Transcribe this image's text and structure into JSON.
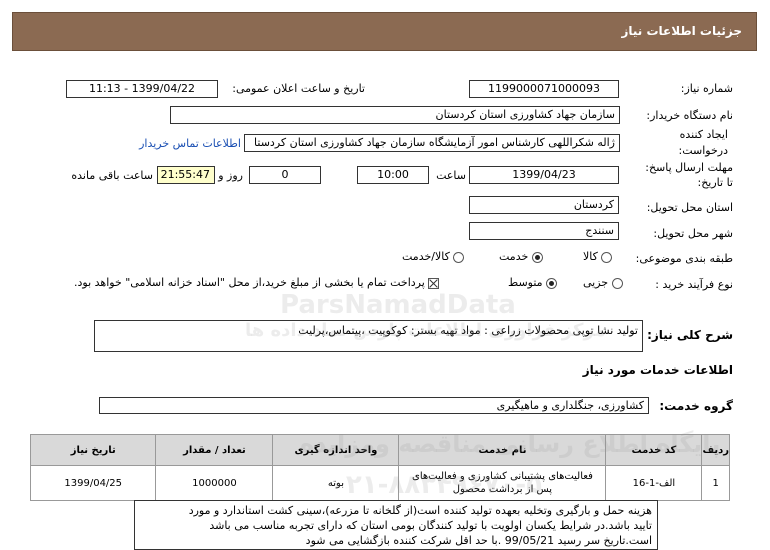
{
  "header": {
    "title": "جزئیات اطلاعات نیاز"
  },
  "fields": {
    "need_number_label": "شماره نیاز:",
    "need_number": "1199000071000093",
    "announce_label": "تاریخ و ساعت اعلان عمومی:",
    "announce_value": "1399/04/22 - 11:13",
    "buyer_label": "نام دستگاه خریدار:",
    "buyer_value": "سازمان جهاد کشاورزی استان کردستان",
    "creator_label_1": "ایجاد کننده",
    "creator_label_2": "درخواست:",
    "creator_value": "ژاله شکراللهی کارشناس امور آزمایشگاه سازمان جهاد کشاورزی استان کردستا",
    "contact_link": "اطلاعات تماس خریدار",
    "deadline_label_1": "مهلت ارسال پاسخ:",
    "deadline_label_2": "تا تاریخ:",
    "deadline_date": "1399/04/23",
    "time_label": "ساعت",
    "deadline_time": "10:00",
    "days_value": "0",
    "days_label": "روز و",
    "remaining_time": "21:55:47",
    "remaining_label": "ساعت باقی مانده",
    "province_label": "استان محل تحویل:",
    "province_value": "کردستان",
    "city_label": "شهر محل تحویل:",
    "city_value": "سنندج",
    "category_label": "طبقه بندی موضوعی:",
    "category_options": [
      "کالا",
      "خدمت",
      "کالا/خدمت"
    ],
    "category_selected": "خدمت",
    "process_label": "نوع فرآیند خرید :",
    "process_options": [
      "جزیی",
      "متوسط"
    ],
    "process_selected": "متوسط",
    "payment_text": "پرداخت تمام یا بخشی از مبلغ خرید،از محل \"اسناد خزانه اسلامی\" خواهد بود."
  },
  "description": {
    "label": "شرح کلی نیاز:",
    "value": "تولید نشا توپی محصولات زراعی : مواد تهیه بستر: کوکوپیت ،پیتماس،پرلیت"
  },
  "services_section": {
    "title": "اطلاعات خدمات مورد نیاز"
  },
  "service_group": {
    "label": "گروه خدمت:",
    "value": "کشاورزی، جنگلداری و ماهیگیری"
  },
  "table": {
    "headers": [
      "ردیف",
      "کد خدمت",
      "نام خدمت",
      "واحد اندازه گیری",
      "تعداد / مقدار",
      "تاریخ نیاز"
    ],
    "rows": [
      [
        "1",
        "الف-1-16",
        "فعالیت‌های پشتیبانی کشاورزی و فعالیت‌های پس از برداشت محصول",
        "بوته",
        "1000000",
        "1399/04/25"
      ]
    ]
  },
  "notes": {
    "line1": "هزینه حمل و بارگیری وتخلیه بعهده تولید کننده است(از گلخانه تا مزرعه)،سینی کشت استاندارد و مورد",
    "line2": "تایید باشد.در شرایط یکسان اولویت با تولید کنندگان بومی استان که دارای تجربه مناسب می باشد",
    "line3": "است.تاریخ سر رسید 99/05/21 .با حد اقل شرکت کننده بازگشایی می شود"
  },
  "watermark": {
    "line1": "ParsNamadData",
    "line2": "مرکز فراوری اطلاعات پارس نماد داده ها",
    "line3": "پایگاه اطلاع رسانی مناقصه ومزایده",
    "line4": "۰۲۱-۸۸۳۴۹۶۷۰-۵"
  },
  "colors": {
    "header_bg": "#8b6a52",
    "remaining_bg": "#ffffcc",
    "link": "#1a4fb3",
    "table_header_bg": "#d9d9d9"
  }
}
